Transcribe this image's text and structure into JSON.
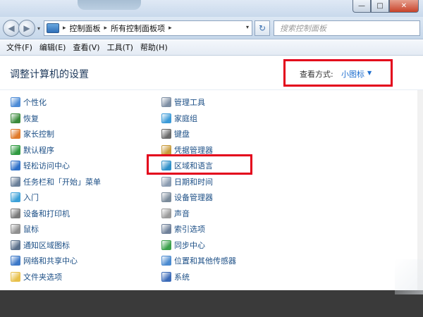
{
  "window": {
    "caption_buttons": {
      "minimize": "—",
      "maximize": "□",
      "close": "✕"
    }
  },
  "nav": {
    "back_icon": "back-arrow-icon",
    "forward_icon": "forward-arrow-icon",
    "address": {
      "crumbs": [
        "控制面板",
        "所有控制面板项"
      ],
      "separator": "▸",
      "dropdown": "▾"
    },
    "refresh_glyph": "↻",
    "search": {
      "placeholder": "搜索控制面板"
    }
  },
  "menu": {
    "items": [
      "文件(F)",
      "编辑(E)",
      "查看(V)",
      "工具(T)",
      "帮助(H)"
    ]
  },
  "header": {
    "title": "调整计算机的设置",
    "view_by_label": "查看方式:",
    "view_by_value": "小图标",
    "view_by_caret": "▼"
  },
  "items_left": [
    {
      "label": "个性化",
      "icon": "personalization-icon",
      "color": "#4c8bd6"
    },
    {
      "label": "恢复",
      "icon": "recovery-icon",
      "color": "#3a8a3a"
    },
    {
      "label": "家长控制",
      "icon": "parental-controls-icon",
      "color": "#e07a2a"
    },
    {
      "label": "默认程序",
      "icon": "default-programs-icon",
      "color": "#2f9a40"
    },
    {
      "label": "轻松访问中心",
      "icon": "ease-of-access-icon",
      "color": "#2c6fc8"
    },
    {
      "label": "任务栏和「开始」菜单",
      "icon": "taskbar-icon",
      "color": "#6a7f99"
    },
    {
      "label": "入门",
      "icon": "getting-started-icon",
      "color": "#3aa0d8"
    },
    {
      "label": "设备和打印机",
      "icon": "printer-icon",
      "color": "#7a7a7a"
    },
    {
      "label": "鼠标",
      "icon": "mouse-icon",
      "color": "#8f8f8f"
    },
    {
      "label": "通知区域图标",
      "icon": "notification-area-icon",
      "color": "#5a6f8a"
    },
    {
      "label": "网络和共享中心",
      "icon": "network-icon",
      "color": "#3b78c8"
    },
    {
      "label": "文件夹选项",
      "icon": "folder-options-icon",
      "color": "#e8c04a"
    }
  ],
  "items_right": [
    {
      "label": "管理工具",
      "icon": "admin-tools-icon",
      "color": "#7d8ea3"
    },
    {
      "label": "家庭组",
      "icon": "homegroup-icon",
      "color": "#3a9ad8"
    },
    {
      "label": "键盘",
      "icon": "keyboard-icon",
      "color": "#6a6a6a"
    },
    {
      "label": "凭据管理器",
      "icon": "credential-manager-icon",
      "color": "#c89a3a"
    },
    {
      "label": "区域和语言",
      "icon": "region-language-icon",
      "color": "#2d8fc8"
    },
    {
      "label": "日期和时间",
      "icon": "date-time-icon",
      "color": "#8a9bb0"
    },
    {
      "label": "设备管理器",
      "icon": "device-manager-icon",
      "color": "#7a8a9a"
    },
    {
      "label": "声音",
      "icon": "sound-icon",
      "color": "#9a9a9a"
    },
    {
      "label": "索引选项",
      "icon": "indexing-options-icon",
      "color": "#6f8099"
    },
    {
      "label": "同步中心",
      "icon": "sync-center-icon",
      "color": "#3aa04a"
    },
    {
      "label": "位置和其他传感器",
      "icon": "location-sensors-icon",
      "color": "#4a8ad0"
    },
    {
      "label": "系统",
      "icon": "system-icon",
      "color": "#3a6ab8"
    }
  ],
  "colors": {
    "link": "#1c4f86",
    "annotation": "#e3001b",
    "accent": "#1f6fcf"
  }
}
